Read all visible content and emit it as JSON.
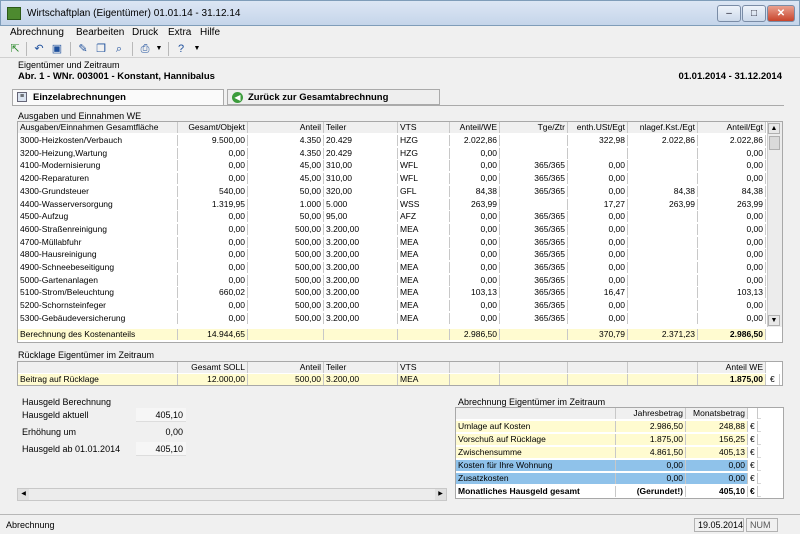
{
  "window": {
    "title": "Wirtschaftplan (Eigentümer) 01.01.14 - 31.12.14"
  },
  "menu": [
    "Abrechnung",
    "Bearbeiten",
    "Druck",
    "Extra",
    "Hilfe"
  ],
  "header": {
    "section_label": "Eigentümer und Zeitraum",
    "owner": "Abr. 1 - WNr. 003001 - Konstant, Hannibalus",
    "period": "01.01.2014 - 31.12.2014"
  },
  "tabs": {
    "active": "Einzelabrechnungen",
    "back": "Zurück zur Gesamtabrechnung"
  },
  "costs": {
    "section_label": "Ausgaben und Einnahmen WE",
    "columns": [
      "Ausgaben/Einnahmen Gesamtfläche",
      "Gesamt/Objekt",
      "Anteil",
      "Teiler",
      "VTS",
      "Anteil/WE",
      "Tge/Ztr",
      "enth.USt/Egt",
      "nlagef.Kst./Egt",
      "Anteil/Egt"
    ],
    "rows": [
      [
        "3000-Heizkosten/Verbauch",
        "9.500,00",
        "4.350",
        "20.429",
        "HZG",
        "2.022,86",
        "",
        "322,98",
        "2.022,86",
        "2.022,86"
      ],
      [
        "3200-Heizung,Wartung",
        "0,00",
        "4.350",
        "20.429",
        "HZG",
        "0,00",
        "",
        "",
        "",
        "0,00"
      ],
      [
        "4100-Modernisierung",
        "0,00",
        "45,00",
        "310,00",
        "WFL",
        "0,00",
        "365/365",
        "0,00",
        "",
        "0,00"
      ],
      [
        "4200-Reparaturen",
        "0,00",
        "45,00",
        "310,00",
        "WFL",
        "0,00",
        "365/365",
        "0,00",
        "",
        "0,00"
      ],
      [
        "4300-Grundsteuer",
        "540,00",
        "50,00",
        "320,00",
        "GFL",
        "84,38",
        "365/365",
        "0,00",
        "84,38",
        "84,38"
      ],
      [
        "4400-Wasserversorgung",
        "1.319,95",
        "1.000",
        "5.000",
        "WSS",
        "263,99",
        "",
        "17,27",
        "263,99",
        "263,99"
      ],
      [
        "4500-Aufzug",
        "0,00",
        "50,00",
        "95,00",
        "AFZ",
        "0,00",
        "365/365",
        "0,00",
        "",
        "0,00"
      ],
      [
        "4600-Straßenreinigung",
        "0,00",
        "500,00",
        "3.200,00",
        "MEA",
        "0,00",
        "365/365",
        "0,00",
        "",
        "0,00"
      ],
      [
        "4700-Müllabfuhr",
        "0,00",
        "500,00",
        "3.200,00",
        "MEA",
        "0,00",
        "365/365",
        "0,00",
        "",
        "0,00"
      ],
      [
        "4800-Hausreinigung",
        "0,00",
        "500,00",
        "3.200,00",
        "MEA",
        "0,00",
        "365/365",
        "0,00",
        "",
        "0,00"
      ],
      [
        "4900-Schneebeseitigung",
        "0,00",
        "500,00",
        "3.200,00",
        "MEA",
        "0,00",
        "365/365",
        "0,00",
        "",
        "0,00"
      ],
      [
        "5000-Gartenanlagen",
        "0,00",
        "500,00",
        "3.200,00",
        "MEA",
        "0,00",
        "365/365",
        "0,00",
        "",
        "0,00"
      ],
      [
        "5100-Strom/Beleuchtung",
        "660,02",
        "500,00",
        "3.200,00",
        "MEA",
        "103,13",
        "365/365",
        "16,47",
        "",
        "103,13"
      ],
      [
        "5200-Schornsteinfeger",
        "0,00",
        "500,00",
        "3.200,00",
        "MEA",
        "0,00",
        "365/365",
        "0,00",
        "",
        "0,00"
      ],
      [
        "5300-Gebäudeversicherung",
        "0,00",
        "500,00",
        "3.200,00",
        "MEA",
        "0,00",
        "365/365",
        "0,00",
        "",
        "0,00"
      ]
    ],
    "total": [
      "Berechnung des Kostenanteils",
      "14.944,65",
      "",
      "",
      "",
      "2.986,50",
      "",
      "370,79",
      "2.371,23",
      "2.986,50"
    ]
  },
  "reserve": {
    "section_label": "Rücklage Eigentümer im Zeitraum",
    "columns": [
      "",
      "Gesamt SOLL",
      "Anteil",
      "Teiler",
      "VTS",
      "",
      "",
      "",
      "",
      "Anteil WE"
    ],
    "row": [
      "Beitrag auf Rücklage",
      "12.000,00",
      "500,00",
      "3.200,00",
      "MEA",
      "",
      "",
      "",
      "",
      "1.875,00"
    ],
    "currency": "€"
  },
  "hausgeld": {
    "section_label": "Hausgeld Berechnung",
    "items": [
      {
        "label": "Hausgeld aktuell",
        "value": "405,10"
      },
      {
        "label": "Erhöhung um",
        "value": "0,00"
      },
      {
        "label": "Hausgeld ab 01.01.2014",
        "value": "405,10"
      }
    ]
  },
  "summary": {
    "section_label": "Abrechnung Eigentümer im Zeitraum",
    "columns": [
      "",
      "Jahresbetrag",
      "Monatsbetrag",
      ""
    ],
    "rows": [
      {
        "label": "Umlage auf Kosten",
        "year": "2.986,50",
        "month": "248,88",
        "cur": "€"
      },
      {
        "label": "Vorschuß auf Rücklage",
        "year": "1.875,00",
        "month": "156,25",
        "cur": "€"
      },
      {
        "label": "Zwischensumme",
        "year": "4.861,50",
        "month": "405,13",
        "cur": "€"
      },
      {
        "label": "Kosten für Ihre Wohnung",
        "year": "0,00",
        "month": "0,00",
        "cur": "€"
      },
      {
        "label": "Zusatzkosten",
        "year": "0,00",
        "month": "0,00",
        "cur": "€"
      },
      {
        "label": "Monatliches Hausgeld gesamt",
        "year": "(Gerundet!)",
        "month": "405,10",
        "cur": "€"
      }
    ]
  },
  "status": {
    "left": "Abrechnung",
    "date": "19.05.2014",
    "mode": "NUM"
  },
  "colors": {
    "yellow": "#fffbd0",
    "blue": "#8fc2ea",
    "title": "#c5d5ea"
  }
}
